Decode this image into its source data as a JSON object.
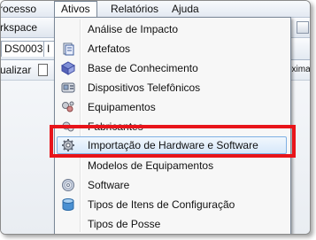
{
  "menubar": {
    "items": [
      {
        "label": "rocesso"
      },
      {
        "label": "Ativos"
      },
      {
        "label": "Relatórios"
      },
      {
        "label": "Ajuda"
      }
    ]
  },
  "toolbar_fragments": {
    "workspace": "rkspace",
    "ds_tab": "DS0003",
    "ds_tab2": "I",
    "atualizar": "ualizar",
    "proxima": "óxima"
  },
  "ativos_menu": {
    "items": [
      {
        "label": "Análise de Impacto",
        "icon": "none"
      },
      {
        "label": "Artefatos",
        "icon": "artefatos-icon"
      },
      {
        "label": "Base de Conhecimento",
        "icon": "knowledge-base-icon"
      },
      {
        "label": "Dispositivos Telefônicos",
        "icon": "phone-device-icon"
      },
      {
        "label": "Equipamentos",
        "icon": "equipment-icon"
      },
      {
        "label": "Fabricantes",
        "icon": "manufacturer-icon"
      },
      {
        "label": "Importação de Hardware e Software",
        "icon": "gear-icon",
        "highlighted": true
      },
      {
        "label": "Modelos de Equipamentos",
        "icon": "none"
      },
      {
        "label": "Software",
        "icon": "cd-icon"
      },
      {
        "label": "Tipos de Itens de Configuração",
        "icon": "database-icon"
      },
      {
        "label": "Tipos de Posse",
        "icon": "none"
      }
    ]
  },
  "colors": {
    "highlight_border": "#7fb1e4",
    "annotation_red": "#e8141a",
    "menu_bg": "#f7f7f7"
  }
}
